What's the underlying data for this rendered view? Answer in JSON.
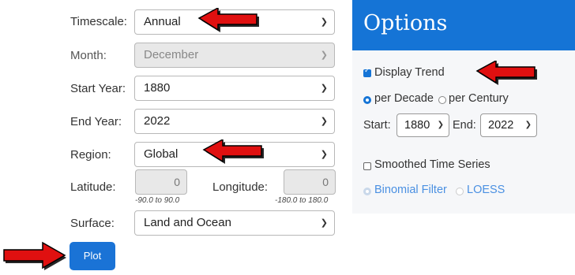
{
  "form": {
    "timescale": {
      "label": "Timescale:",
      "value": "Annual"
    },
    "month": {
      "label": "Month:",
      "value": "December"
    },
    "start_year": {
      "label": "Start Year:",
      "value": "1880"
    },
    "end_year": {
      "label": "End Year:",
      "value": "2022"
    },
    "region": {
      "label": "Region:",
      "value": "Global"
    },
    "latitude": {
      "label": "Latitude:",
      "value": "0",
      "hint": "-90.0 to 90.0"
    },
    "longitude": {
      "label": "Longitude:",
      "value": "0",
      "hint": "-180.0 to 180.0"
    },
    "surface": {
      "label": "Surface:",
      "value": "Land and Ocean"
    },
    "plot_label": "Plot"
  },
  "options": {
    "title": "Options",
    "display_trend": "Display Trend",
    "per_decade": "per Decade",
    "per_century": "per Century",
    "start_label": "Start:",
    "start_value": "1880",
    "end_label": "End:",
    "end_value": "2022",
    "smoothed": "Smoothed Time Series",
    "binomial": "Binomial Filter",
    "loess": "LOESS"
  },
  "colors": {
    "accent": "#1574d6",
    "arrow": "#e01010"
  }
}
